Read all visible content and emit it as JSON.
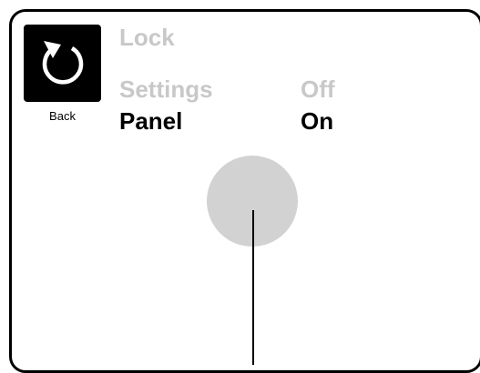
{
  "back_button": {
    "icon": "undo-arrow-icon",
    "label": "Back"
  },
  "menu": {
    "title": "Lock",
    "rows": [
      {
        "label": "Settings",
        "value": "Off",
        "state": "inactive"
      },
      {
        "label": "Panel",
        "value": "On",
        "state": "active"
      }
    ]
  },
  "colors": {
    "inactive_text": "#c8c8c8",
    "active_text": "#000000",
    "knob": "#d2d2d2",
    "button_bg": "#000000"
  }
}
